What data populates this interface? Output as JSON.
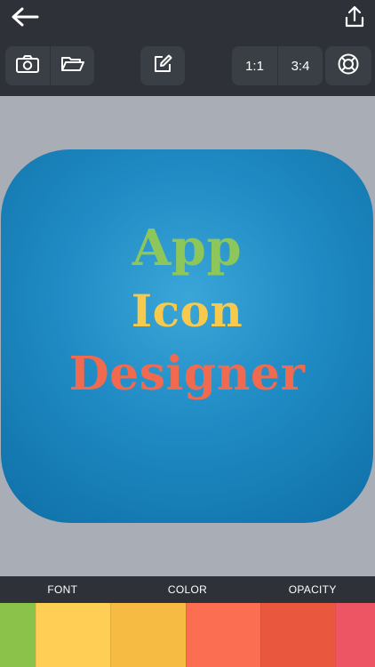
{
  "toolbar": {
    "ratio_square": "1:1",
    "ratio_portrait": "3:4"
  },
  "icon": {
    "line1": "App",
    "line2": "Icon",
    "line3": "Designer",
    "line1_color": "#8dc65a",
    "line2_color": "#f7c94c",
    "line3_color": "#f06a50"
  },
  "tabs": {
    "font": "FONT",
    "color": "COLOR",
    "opacity": "OPACITY"
  },
  "swatches": [
    {
      "name": "green",
      "color": "#8bc34a"
    },
    {
      "name": "yellow",
      "color": "#ffce54"
    },
    {
      "name": "amber",
      "color": "#f6bb42"
    },
    {
      "name": "coral",
      "color": "#fc6e51"
    },
    {
      "name": "red-orange",
      "color": "#e9573f"
    },
    {
      "name": "pink-red",
      "color": "#ed5565"
    }
  ]
}
